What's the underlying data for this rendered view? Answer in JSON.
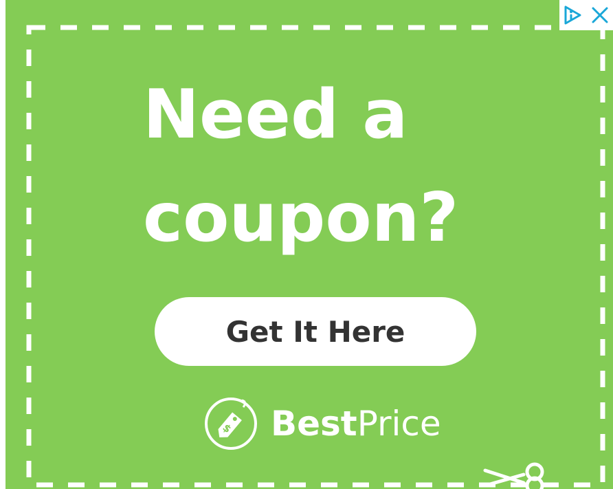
{
  "ad": {
    "headline_line1": "Need a",
    "headline_line2": "coupon?",
    "cta_label": "Get It Here",
    "brand": {
      "name_bold": "Best",
      "name_light": "Price",
      "logo_icon": "price-tag-dollar-icon"
    },
    "icons": {
      "scissors": "scissors-icon",
      "adchoices": "adchoices-icon",
      "close": "close-icon"
    }
  },
  "colors": {
    "background": "#84cc55",
    "text": "#ffffff",
    "button_bg": "#ffffff",
    "button_text": "#333333",
    "adchoices": "#1aa7d8"
  }
}
